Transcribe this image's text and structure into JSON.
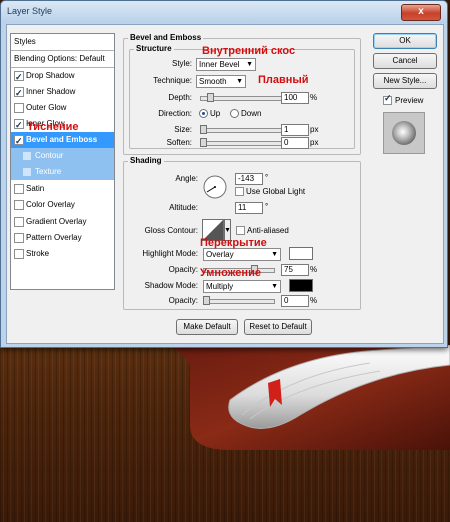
{
  "window": {
    "title": "Layer Style",
    "close": "x"
  },
  "left_list": [
    {
      "label": "Styles",
      "type": "header"
    },
    {
      "label": "Blending Options: Default",
      "type": "header"
    },
    {
      "label": "Drop Shadow",
      "checked": true
    },
    {
      "label": "Inner Shadow",
      "checked": true
    },
    {
      "label": "Outer Glow",
      "checked": false
    },
    {
      "label": "Inner Glow",
      "checked": true
    },
    {
      "label": "Bevel and Emboss",
      "checked": true,
      "selected": true
    },
    {
      "label": "Contour",
      "sub": true
    },
    {
      "label": "Texture",
      "sub": true
    },
    {
      "label": "Satin",
      "checked": false
    },
    {
      "label": "Color Overlay",
      "checked": false
    },
    {
      "label": "Gradient Overlay",
      "checked": false
    },
    {
      "label": "Pattern Overlay",
      "checked": false
    },
    {
      "label": "Stroke",
      "checked": false
    }
  ],
  "bevel": {
    "group_title": "Bevel and Emboss",
    "structure_title": "Structure",
    "style_label": "Style:",
    "style_value": "Inner Bevel",
    "technique_label": "Technique:",
    "technique_value": "Smooth",
    "depth_label": "Depth:",
    "depth_value": "100",
    "depth_unit": "%",
    "depth_level": 0.1,
    "direction_label": "Direction:",
    "dir_up": "Up",
    "dir_down": "Down",
    "size_label": "Size:",
    "size_value": "1",
    "size_unit": "px",
    "size_level": 0.0,
    "soften_label": "Soften:",
    "soften_value": "0",
    "soften_unit": "px",
    "soften_level": 0.0
  },
  "shading": {
    "title": "Shading",
    "angle_label": "Angle:",
    "angle_value": "-143",
    "angle_unit": "°",
    "use_global_light": "Use Global Light",
    "altitude_label": "Altitude:",
    "altitude_value": "11",
    "altitude_unit": "°",
    "gloss_label": "Gloss Contour:",
    "anti_aliased": "Anti-aliased",
    "highlight_mode_label": "Highlight Mode:",
    "highlight_mode_value": "Overlay",
    "highlight_color": "#ffffff",
    "opacity1_label": "Opacity:",
    "opacity1_value": "75",
    "opacity1_unit": "%",
    "opacity1_level": 0.75,
    "shadow_mode_label": "Shadow Mode:",
    "shadow_mode_value": "Multiply",
    "shadow_color": "#000000",
    "opacity2_label": "Opacity:",
    "opacity2_value": "0",
    "opacity2_unit": "%",
    "opacity2_level": 0.0
  },
  "buttons": {
    "make_default": "Make Default",
    "reset_default": "Reset to Default",
    "ok": "OK",
    "cancel": "Cancel",
    "new_style": "New Style...",
    "preview": "Preview"
  },
  "annotations": {
    "inner_bevel": "Внутренний скос",
    "smooth": "Плавный",
    "emboss": "Тиснение",
    "overlay": "Перекрытие",
    "multiply": "Умножение"
  },
  "colors": {
    "selection": "#3399ff",
    "sub_selection": "#8fc1f0",
    "annotation": "#d01010",
    "ok_border": "#3c7fb1"
  }
}
